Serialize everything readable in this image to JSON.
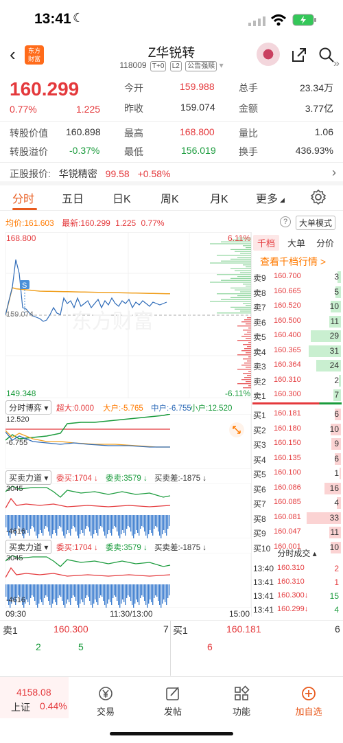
{
  "status": {
    "time": "13:41"
  },
  "header": {
    "title": "Z华锐转",
    "code": "118009",
    "tag1": "T+0",
    "tag2": "L2",
    "tag3": "公告强赎",
    "logo_line1": "东方",
    "logo_line2": "财富"
  },
  "quote": {
    "price": "160.299",
    "pct": "0.77%",
    "change": "1.225",
    "open_label": "今开",
    "open": "159.988",
    "prev_label": "昨收",
    "prev": "159.074",
    "vol_label": "总手",
    "vol": "23.34万",
    "amt_label": "金额",
    "amt": "3.77亿",
    "conv_label": "转股价值",
    "conv": "160.898",
    "high_label": "最高",
    "high": "168.800",
    "ratio_label": "量比",
    "ratio": "1.06",
    "prem_label": "转股溢价",
    "prem": "-0.37%",
    "low_label": "最低",
    "low": "156.019",
    "turn_label": "换手",
    "turn": "436.93%"
  },
  "stock": {
    "label": "正股报价:",
    "name": "华锐精密",
    "price": "99.58",
    "pct": "+0.58%"
  },
  "tabs": [
    "分时",
    "五日",
    "日K",
    "周K",
    "月K",
    "更多"
  ],
  "chartinfo": {
    "avg_label": "均价:",
    "avg": "161.603",
    "last_label": "最新:",
    "last": "160.299",
    "chg": "1.225",
    "pct": "0.77%",
    "btn": "大单模式"
  },
  "chart": {
    "max": "168.800",
    "min": "149.348",
    "maxpct": "6.11%",
    "minpct": "-6.11%",
    "prev": "159.074",
    "watermark": "东方财富",
    "s_marker": "S",
    "bottom_left": "09:30",
    "bottom_mid": "11:30/13:00",
    "bottom_right": "15:00"
  },
  "game": {
    "title": "分时博弈",
    "super": "超大:0.000",
    "big": "大户:-5.765",
    "mid": "中户:-6.755",
    "small": "小户:12.520",
    "top": "12.520",
    "low": "-6.755"
  },
  "force": {
    "title": "买卖力道",
    "buy": "委买:1704",
    "sell": "委卖:3579",
    "diff": "买卖差:-1875",
    "top": "3045",
    "low": "-4616"
  },
  "side": {
    "tabs": [
      "千档",
      "大单",
      "分价"
    ],
    "link": "查看千档行情 >"
  },
  "sells": [
    {
      "l": "卖9",
      "p": "160.700",
      "v": "3"
    },
    {
      "l": "卖8",
      "p": "160.665",
      "v": "5"
    },
    {
      "l": "卖7",
      "p": "160.520",
      "v": "10"
    },
    {
      "l": "卖6",
      "p": "160.500",
      "v": "11"
    },
    {
      "l": "卖5",
      "p": "160.400",
      "v": "29"
    },
    {
      "l": "卖4",
      "p": "160.365",
      "v": "31"
    },
    {
      "l": "卖3",
      "p": "160.364",
      "v": "24"
    },
    {
      "l": "卖2",
      "p": "160.310",
      "v": "2"
    },
    {
      "l": "卖1",
      "p": "160.300",
      "v": "7"
    }
  ],
  "buys": [
    {
      "l": "买1",
      "p": "160.181",
      "v": "6"
    },
    {
      "l": "买2",
      "p": "160.180",
      "v": "10"
    },
    {
      "l": "买3",
      "p": "160.150",
      "v": "9"
    },
    {
      "l": "买4",
      "p": "160.135",
      "v": "6"
    },
    {
      "l": "买5",
      "p": "160.100",
      "v": "1"
    },
    {
      "l": "买6",
      "p": "160.086",
      "v": "16"
    },
    {
      "l": "买7",
      "p": "160.085",
      "v": "4"
    },
    {
      "l": "买8",
      "p": "160.081",
      "v": "33"
    },
    {
      "l": "买9",
      "p": "160.047",
      "v": "11"
    },
    {
      "l": "买10",
      "p": "160.001",
      "v": "10"
    }
  ],
  "trades_title": "分时成交",
  "trades": [
    {
      "t": "13:40",
      "p": "160.310",
      "v": "2"
    },
    {
      "t": "13:41",
      "p": "160.310",
      "v": "1"
    },
    {
      "t": "13:41",
      "p": "160.300↓",
      "v": "15"
    },
    {
      "t": "13:41",
      "p": "160.299↓",
      "v": "4"
    }
  ],
  "l1": {
    "sell_label": "卖1",
    "sell_price": "160.300",
    "sell_vol": "7",
    "buy_label": "买1",
    "buy_price": "160.181",
    "buy_vol": "6",
    "q1": "2",
    "q2": "5",
    "q3": "6"
  },
  "bottom": {
    "index": "4158.08",
    "index_name": "上证",
    "index_pct": "0.44%",
    "trade": "交易",
    "post": "发帖",
    "func": "功能",
    "add": "加自选"
  }
}
